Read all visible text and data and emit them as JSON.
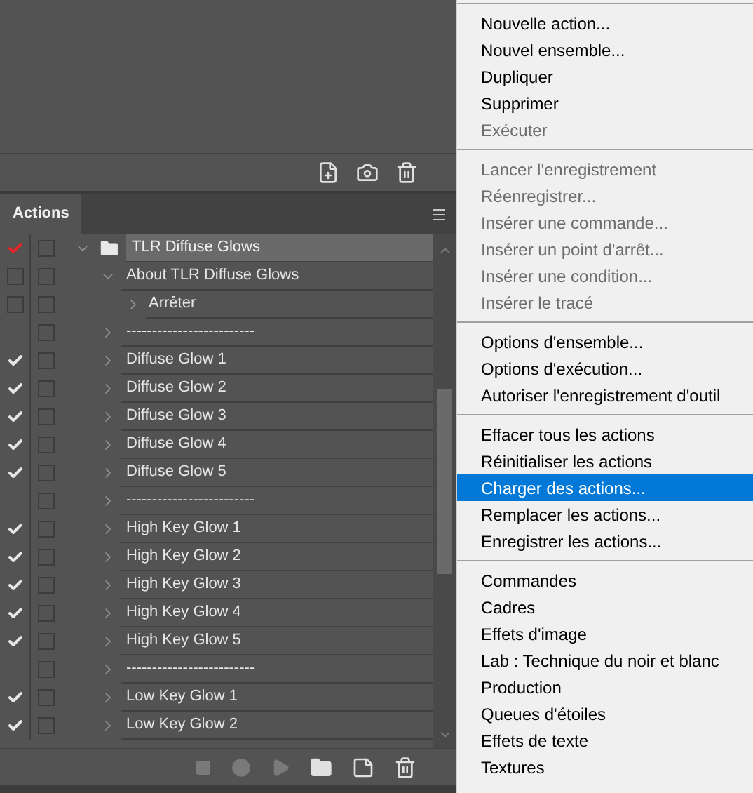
{
  "panel": {
    "tab": {
      "label": "Actions",
      "selected": true
    },
    "rows": [
      {
        "label": "TLR Diffuse Glows",
        "kind": "set",
        "checked": true,
        "partial": true,
        "dialog": false,
        "expanded": true,
        "selected": true,
        "children": [
          {
            "label": "About TLR Diffuse Glows",
            "kind": "action",
            "checked": false,
            "dialog": false,
            "expanded": true,
            "selected": false,
            "children": [
              {
                "label": "Arrêter",
                "kind": "step",
                "checked": false,
                "dialog": false,
                "expanded": false,
                "selected": false
              }
            ]
          },
          {
            "label": "-------------------------",
            "kind": "action",
            "dialog": false,
            "expanded": false,
            "selected": false
          },
          {
            "label": "Diffuse Glow 1",
            "kind": "action",
            "checked": true,
            "dialog": false,
            "expanded": false,
            "selected": false
          },
          {
            "label": "Diffuse Glow 2",
            "kind": "action",
            "checked": true,
            "dialog": false,
            "expanded": false,
            "selected": false
          },
          {
            "label": "Diffuse Glow 3",
            "kind": "action",
            "checked": true,
            "dialog": false,
            "expanded": false,
            "selected": false
          },
          {
            "label": "Diffuse Glow 4",
            "kind": "action",
            "checked": true,
            "dialog": false,
            "expanded": false,
            "selected": false
          },
          {
            "label": "Diffuse Glow 5",
            "kind": "action",
            "checked": true,
            "dialog": false,
            "expanded": false,
            "selected": false
          },
          {
            "label": "-------------------------",
            "kind": "action",
            "dialog": false,
            "expanded": false,
            "selected": false
          },
          {
            "label": "High Key Glow 1",
            "kind": "action",
            "checked": true,
            "dialog": false,
            "expanded": false,
            "selected": false
          },
          {
            "label": "High Key Glow 2",
            "kind": "action",
            "checked": true,
            "dialog": false,
            "expanded": false,
            "selected": false
          },
          {
            "label": "High Key Glow 3",
            "kind": "action",
            "checked": true,
            "dialog": false,
            "expanded": false,
            "selected": false
          },
          {
            "label": "High Key Glow 4",
            "kind": "action",
            "checked": true,
            "dialog": false,
            "expanded": false,
            "selected": false
          },
          {
            "label": "High Key Glow 5",
            "kind": "action",
            "checked": true,
            "dialog": false,
            "expanded": false,
            "selected": false
          },
          {
            "label": "-------------------------",
            "kind": "action",
            "dialog": false,
            "expanded": false,
            "selected": false
          },
          {
            "label": "Low Key Glow 1",
            "kind": "action",
            "checked": true,
            "dialog": false,
            "expanded": false,
            "selected": false
          },
          {
            "label": "Low Key Glow 2",
            "kind": "action",
            "checked": true,
            "dialog": false,
            "expanded": false,
            "selected": false
          }
        ]
      }
    ]
  },
  "menu": [
    {
      "kind": "separator"
    },
    {
      "kind": "item",
      "label": "Nouvelle action...",
      "disabled": false,
      "selected": false
    },
    {
      "kind": "item",
      "label": "Nouvel ensemble...",
      "disabled": false,
      "selected": false
    },
    {
      "kind": "item",
      "label": "Dupliquer",
      "disabled": false,
      "selected": false
    },
    {
      "kind": "item",
      "label": "Supprimer",
      "disabled": false,
      "selected": false
    },
    {
      "kind": "item",
      "label": "Exécuter",
      "disabled": true,
      "selected": false
    },
    {
      "kind": "separator"
    },
    {
      "kind": "item",
      "label": "Lancer l'enregistrement",
      "disabled": true,
      "selected": false
    },
    {
      "kind": "item",
      "label": "Réenregistrer...",
      "disabled": true,
      "selected": false
    },
    {
      "kind": "item",
      "label": "Insérer une commande...",
      "disabled": true,
      "selected": false
    },
    {
      "kind": "item",
      "label": "Insérer un point d'arrêt...",
      "disabled": true,
      "selected": false
    },
    {
      "kind": "item",
      "label": "Insérer une condition...",
      "disabled": true,
      "selected": false
    },
    {
      "kind": "item",
      "label": "Insérer le tracé",
      "disabled": true,
      "selected": false
    },
    {
      "kind": "separator"
    },
    {
      "kind": "item",
      "label": "Options d'ensemble...",
      "disabled": false,
      "selected": false
    },
    {
      "kind": "item",
      "label": "Options d'exécution...",
      "disabled": false,
      "selected": false
    },
    {
      "kind": "item",
      "label": "Autoriser l'enregistrement d'outil",
      "disabled": false,
      "selected": false
    },
    {
      "kind": "separator"
    },
    {
      "kind": "item",
      "label": "Effacer tous les actions",
      "disabled": false,
      "selected": false
    },
    {
      "kind": "item",
      "label": "Réinitialiser les actions",
      "disabled": false,
      "selected": false
    },
    {
      "kind": "item",
      "label": "Charger des actions...",
      "disabled": false,
      "selected": true
    },
    {
      "kind": "item",
      "label": "Remplacer les actions...",
      "disabled": false,
      "selected": false
    },
    {
      "kind": "item",
      "label": "Enregistrer les actions...",
      "disabled": false,
      "selected": false
    },
    {
      "kind": "separator"
    },
    {
      "kind": "item",
      "label": "Commandes",
      "disabled": false,
      "selected": false
    },
    {
      "kind": "item",
      "label": "Cadres",
      "disabled": false,
      "selected": false
    },
    {
      "kind": "item",
      "label": "Effets d'image",
      "disabled": false,
      "selected": false
    },
    {
      "kind": "item",
      "label": "Lab : Technique du noir et blanc",
      "disabled": false,
      "selected": false
    },
    {
      "kind": "item",
      "label": "Production",
      "disabled": false,
      "selected": false
    },
    {
      "kind": "item",
      "label": "Queues d'étoiles",
      "disabled": false,
      "selected": false
    },
    {
      "kind": "item",
      "label": "Effets de texte",
      "disabled": false,
      "selected": false
    },
    {
      "kind": "item",
      "label": "Textures",
      "disabled": false,
      "selected": false
    }
  ]
}
